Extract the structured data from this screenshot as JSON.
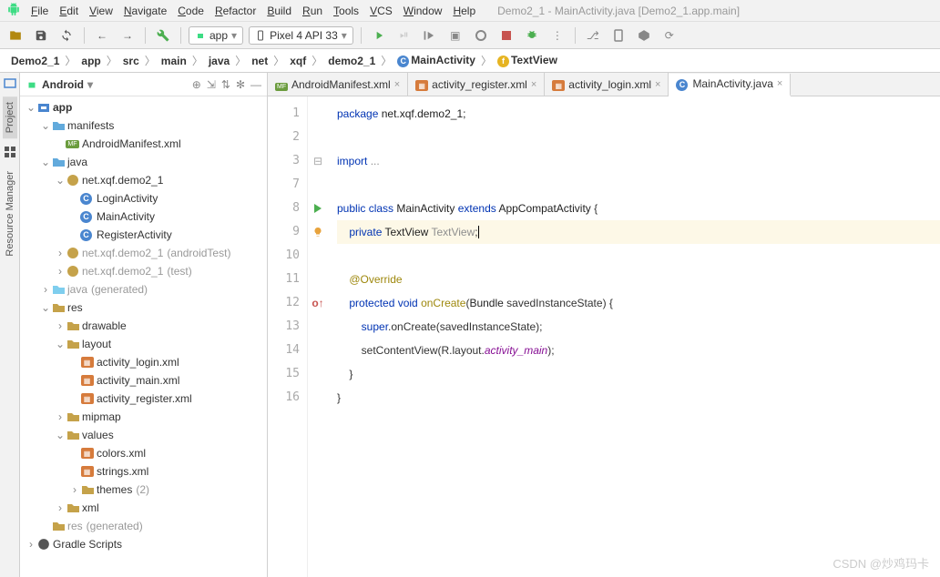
{
  "window": {
    "title": "Demo2_1 - MainActivity.java [Demo2_1.app.main]"
  },
  "menus": [
    "File",
    "Edit",
    "View",
    "Navigate",
    "Code",
    "Refactor",
    "Build",
    "Run",
    "Tools",
    "VCS",
    "Window",
    "Help"
  ],
  "runConfig": {
    "app": "app",
    "device": "Pixel 4 API 33"
  },
  "breadcrumbs": [
    {
      "label": "Demo2_1"
    },
    {
      "label": "app"
    },
    {
      "label": "src"
    },
    {
      "label": "main"
    },
    {
      "label": "java"
    },
    {
      "label": "net"
    },
    {
      "label": "xqf"
    },
    {
      "label": "demo2_1"
    },
    {
      "label": "MainActivity",
      "icon": "class"
    },
    {
      "label": "TextView",
      "icon": "field"
    }
  ],
  "rails": {
    "project": "Project",
    "resourceManager": "Resource Manager"
  },
  "sidebar": {
    "selector": "Android",
    "nodes": [
      {
        "indent": 0,
        "toggle": "v",
        "icon": "module",
        "label": "app",
        "bold": true
      },
      {
        "indent": 1,
        "toggle": "v",
        "icon": "folder",
        "label": "manifests"
      },
      {
        "indent": 2,
        "toggle": "",
        "icon": "mf",
        "label": "AndroidManifest.xml"
      },
      {
        "indent": 1,
        "toggle": "v",
        "icon": "folder",
        "label": "java"
      },
      {
        "indent": 2,
        "toggle": "v",
        "icon": "pkg",
        "label": "net.xqf.demo2_1"
      },
      {
        "indent": 3,
        "toggle": "",
        "icon": "class",
        "label": "LoginActivity"
      },
      {
        "indent": 3,
        "toggle": "",
        "icon": "class",
        "label": "MainActivity"
      },
      {
        "indent": 3,
        "toggle": "",
        "icon": "class",
        "label": "RegisterActivity"
      },
      {
        "indent": 2,
        "toggle": ">",
        "icon": "pkg",
        "label": "net.xqf.demo2_1",
        "hint": "(androidTest)",
        "muted": true
      },
      {
        "indent": 2,
        "toggle": ">",
        "icon": "pkg",
        "label": "net.xqf.demo2_1",
        "hint": "(test)",
        "muted": true
      },
      {
        "indent": 1,
        "toggle": ">",
        "icon": "genfolder",
        "label": "java",
        "hint": "(generated)",
        "muted": true
      },
      {
        "indent": 1,
        "toggle": "v",
        "icon": "resfolder",
        "label": "res"
      },
      {
        "indent": 2,
        "toggle": ">",
        "icon": "resfolder",
        "label": "drawable"
      },
      {
        "indent": 2,
        "toggle": "v",
        "icon": "resfolder",
        "label": "layout"
      },
      {
        "indent": 3,
        "toggle": "",
        "icon": "layout",
        "label": "activity_login.xml"
      },
      {
        "indent": 3,
        "toggle": "",
        "icon": "layout",
        "label": "activity_main.xml"
      },
      {
        "indent": 3,
        "toggle": "",
        "icon": "layout",
        "label": "activity_register.xml"
      },
      {
        "indent": 2,
        "toggle": ">",
        "icon": "resfolder",
        "label": "mipmap"
      },
      {
        "indent": 2,
        "toggle": "v",
        "icon": "resfolder",
        "label": "values"
      },
      {
        "indent": 3,
        "toggle": "",
        "icon": "layout",
        "label": "colors.xml"
      },
      {
        "indent": 3,
        "toggle": "",
        "icon": "layout",
        "label": "strings.xml"
      },
      {
        "indent": 3,
        "toggle": ">",
        "icon": "resfolder",
        "label": "themes",
        "hint": "(2)"
      },
      {
        "indent": 2,
        "toggle": ">",
        "icon": "resfolder",
        "label": "xml"
      },
      {
        "indent": 1,
        "toggle": "",
        "icon": "resfolder",
        "label": "res",
        "hint": "(generated)",
        "muted": true
      },
      {
        "indent": 0,
        "toggle": ">",
        "icon": "gradle",
        "label": "Gradle Scripts",
        "bold": false,
        "gradle": true
      }
    ]
  },
  "tabs": [
    {
      "label": "AndroidManifest.xml",
      "icon": "mf"
    },
    {
      "label": "activity_register.xml",
      "icon": "layout"
    },
    {
      "label": "activity_login.xml",
      "icon": "layout"
    },
    {
      "label": "MainActivity.java",
      "icon": "class",
      "active": true
    }
  ],
  "code": {
    "lines": [
      {
        "n": 1,
        "html": "<span class='kw'>package</span> <span class='plain'>net.xqf.demo2_1;</span>"
      },
      {
        "n": 2,
        "html": ""
      },
      {
        "n": 3,
        "html": "<span class='kw'>import</span> <span class='grey'>...</span>",
        "fold": "[+]"
      },
      {
        "n": 7,
        "html": ""
      },
      {
        "n": 8,
        "html": "<span class='kw'>public class</span> <span class='cls'>MainActivity</span> <span class='kw'>extends</span> <span class='cls'>AppCompatActivity</span> {",
        "gi": "run"
      },
      {
        "n": 9,
        "html": "    <span class='kw'>private</span> <span class='cls'>TextView</span> <span class='grey'>TextView</span>;<span class='cursor'></span>",
        "hl": true,
        "gi": "bulb"
      },
      {
        "n": 10,
        "html": ""
      },
      {
        "n": 11,
        "html": "    <span class='ann'>@Override</span>"
      },
      {
        "n": 12,
        "html": "    <span class='kw'>protected void</span> <span class='ann'>onCreate</span>(<span class='cls'>Bundle</span> savedInstanceState) {",
        "gi": "override"
      },
      {
        "n": 13,
        "html": "        <span class='kw'>super</span>.onCreate(savedInstanceState);"
      },
      {
        "n": 14,
        "html": "        setContentView(R.layout.<span class='id' style='font-style:italic'>activity_main</span>);"
      },
      {
        "n": 15,
        "html": "    }"
      },
      {
        "n": 16,
        "html": "}"
      }
    ]
  },
  "watermark": "CSDN @炒鸡玛卡"
}
